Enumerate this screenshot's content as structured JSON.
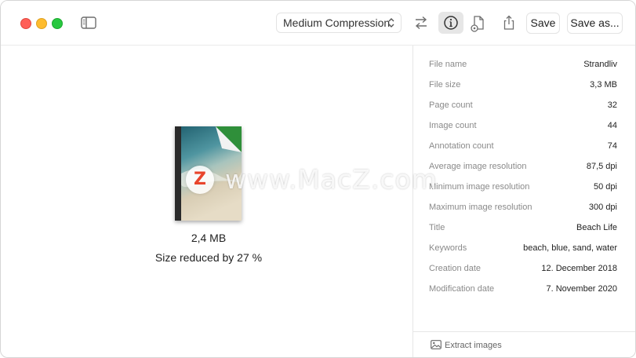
{
  "toolbar": {
    "compression_label": "Medium Compression",
    "save_label": "Save",
    "save_as_label": "Save as..."
  },
  "preview": {
    "file_size": "2,4 MB",
    "reduction": "Size reduced by 27 %"
  },
  "info": [
    {
      "key": "File name",
      "value": "Strandliv"
    },
    {
      "key": "File size",
      "value": "3,3 MB"
    },
    {
      "key": "Page count",
      "value": "32"
    },
    {
      "key": "Image count",
      "value": "44"
    },
    {
      "key": "Annotation count",
      "value": "74"
    },
    {
      "key": "Average image resolution",
      "value": "87,5 dpi"
    },
    {
      "key": "Minimum image resolution",
      "value": "50 dpi"
    },
    {
      "key": "Maximum image resolution",
      "value": "300 dpi"
    },
    {
      "key": "Title",
      "value": "Beach Life"
    },
    {
      "key": "Keywords",
      "value": "beach, blue, sand, water"
    },
    {
      "key": "Creation date",
      "value": "12. December 2018"
    },
    {
      "key": "Modification date",
      "value": "7. November 2020"
    }
  ],
  "footer": {
    "extract_label": "Extract images"
  },
  "watermark": {
    "badge": "Z",
    "text": "www.MacZ.com"
  },
  "colors": {
    "close": "#ff5f57",
    "minimize": "#febc2e",
    "maximize": "#28c840",
    "pdf_corner": "#2f8f3a"
  },
  "icons": [
    "sidebar-icon",
    "chevron-updown-icon",
    "swap-arrows-icon",
    "info-icon",
    "document-gear-icon",
    "share-icon",
    "photo-icon"
  ]
}
